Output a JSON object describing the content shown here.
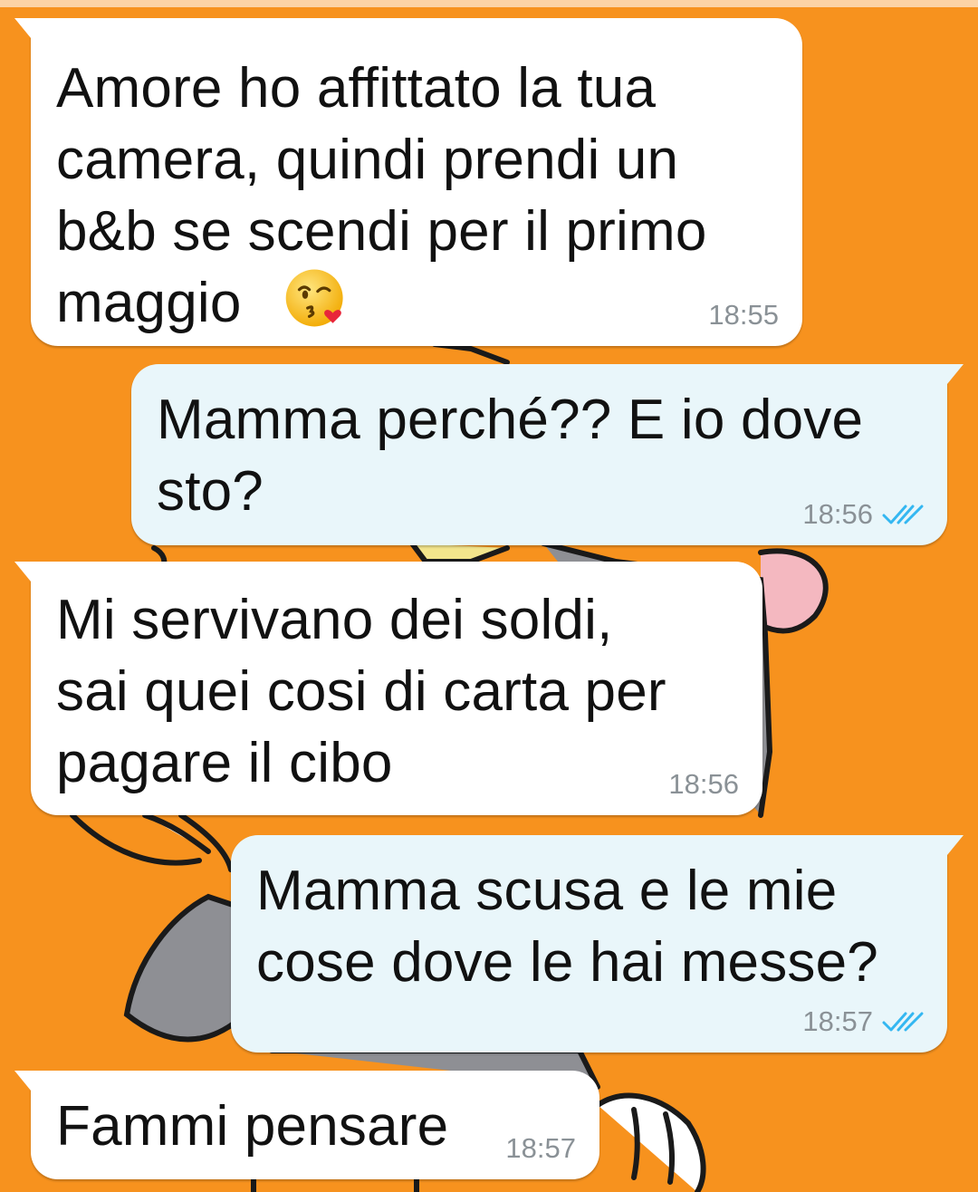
{
  "theme": {
    "wallpaper_color": "#F7921E",
    "incoming_bubble_color": "#FFFFFF",
    "outgoing_bubble_color": "#E9F6FA",
    "read_tick_color": "#34B7F1"
  },
  "messages": [
    {
      "direction": "incoming",
      "text": "Amore ho affittato la tua\ncamera, quindi prendi un\nb&b se scendi per il primo\nmaggio",
      "emoji": "kissing-face-with-heart-icon",
      "time": "18:55"
    },
    {
      "direction": "outgoing",
      "text": "Mamma perché?? E io dove\nsto?",
      "time": "18:56",
      "status": "read"
    },
    {
      "direction": "incoming",
      "text": "Mi servivano dei soldi,\nsai quei cosi di carta per\npagare il cibo",
      "time": "18:56"
    },
    {
      "direction": "outgoing",
      "text": "Mamma scusa e le mie\ncose dove le hai messe?",
      "time": "18:57",
      "status": "read"
    },
    {
      "direction": "incoming",
      "text": "Fammi pensare",
      "time": "18:57"
    }
  ]
}
